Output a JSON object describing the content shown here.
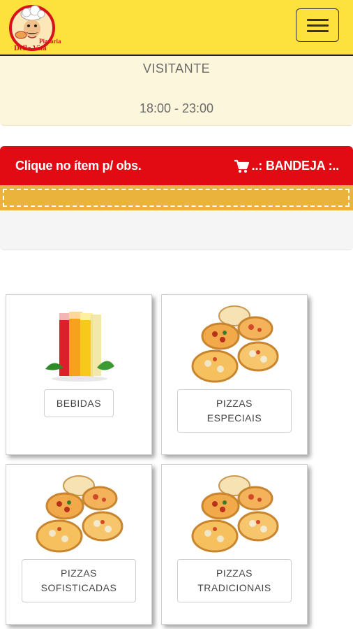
{
  "navbar": {
    "logo_name": "Pizzaria Della Vita",
    "menu_icon": "hamburger-icon",
    "brand_color": "#fde13d"
  },
  "info": {
    "user": "VISITANTE",
    "hours": "18:00 - 23:00"
  },
  "tray": {
    "hint": "Clique no ítem p/ obs.",
    "cart_icon": "cart-icon",
    "title": "..: BANDEJA :..",
    "accent_color": "#e20b14"
  },
  "categories": [
    {
      "label": "BEBIDAS",
      "icon": "juice-glasses-icon"
    },
    {
      "label": "PIZZAS\nESPECIAIS",
      "icon": "pizzas-icon"
    },
    {
      "label": "PIZZAS\nSOFISTICADAS",
      "icon": "pizzas-icon"
    },
    {
      "label": "PIZZAS\nTRADICIONAIS",
      "icon": "pizzas-icon"
    }
  ]
}
